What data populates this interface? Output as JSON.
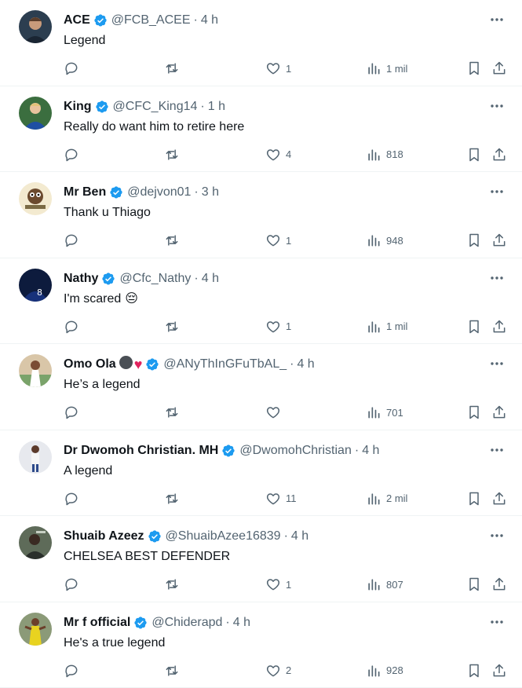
{
  "tweets": [
    {
      "name": "ACE",
      "badges": [],
      "handle": "@FCB_ACEE",
      "time": "4 h",
      "text": "Legend",
      "likes": "1",
      "views": "1 mil",
      "avatar": "ace"
    },
    {
      "name": "King",
      "badges": [],
      "handle": "@CFC_King14",
      "time": "1 h",
      "text": "Really do want him to retire here",
      "likes": "4",
      "views": "818",
      "avatar": "king"
    },
    {
      "name": "Mr Ben",
      "badges": [],
      "handle": "@dejvon01",
      "time": "3 h",
      "text": "Thank u Thiago",
      "likes": "1",
      "views": "948",
      "avatar": "ben"
    },
    {
      "name": "Nathy",
      "badges": [],
      "handle": "@Cfc_Nathy",
      "time": "4 h",
      "text": "I'm scared",
      "text_emoji": "😔",
      "likes": "1",
      "views": "1 mil",
      "avatar": "nathy"
    },
    {
      "name": "Omo Ola",
      "badges": [
        "dark-circle",
        "red-heart"
      ],
      "handle": "@ANyThInGFuTbAL_",
      "time": "4 h",
      "text": "He’s a legend",
      "likes": "",
      "views": "701",
      "avatar": "omo"
    },
    {
      "name": "Dr Dwomoh Christian. MH",
      "badges": [],
      "handle": "@DwomohChristian",
      "time": "4 h",
      "text": "A legend",
      "likes": "11",
      "views": "2 mil",
      "avatar": "dwomoh"
    },
    {
      "name": "Shuaib Azeez",
      "badges": [],
      "handle": "@ShuaibAzee16839",
      "time": "4 h",
      "text": "CHELSEA BEST DEFENDER",
      "likes": "1",
      "views": "807",
      "avatar": "shuaib"
    },
    {
      "name": "Mr f official",
      "badges": [],
      "handle": "@Chiderapd",
      "time": "4 h",
      "text": "He's a true legend",
      "likes": "2",
      "views": "928",
      "avatar": "mrf"
    }
  ],
  "separator": "·",
  "icons": {
    "reply": "reply-icon",
    "retweet": "retweet-icon",
    "like": "heart-icon",
    "views": "views-chart-icon",
    "bookmark": "bookmark-icon",
    "share": "share-icon",
    "more": "more-dots-icon",
    "verified": "verified-badge-icon"
  },
  "colors": {
    "text": "#0f1419",
    "muted": "#536471",
    "verified": "#1d9bf0",
    "divider": "#eff3f4",
    "heart_emoji": "#e0245e"
  }
}
